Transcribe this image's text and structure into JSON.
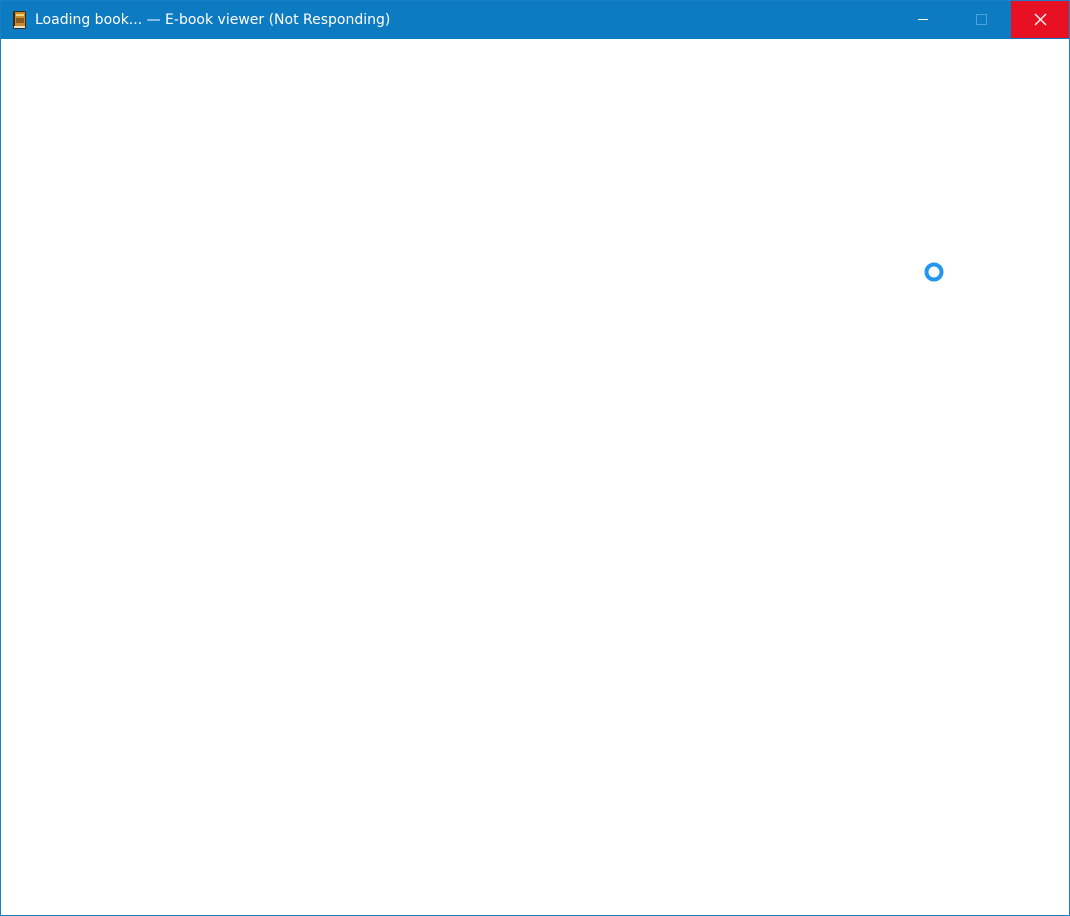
{
  "window": {
    "title": "Loading book... — E-book viewer (Not Responding)",
    "app_icon": "ebook-viewer-icon",
    "controls": {
      "minimize": "minimize-icon",
      "maximize": "maximize-icon",
      "close": "close-icon"
    },
    "colors": {
      "titlebar": "#0d7bc1",
      "close_button": "#e81123",
      "busy_cursor": "#2196f3"
    }
  },
  "content": {
    "state": "loading",
    "cursor": "busy-cursor-icon"
  }
}
